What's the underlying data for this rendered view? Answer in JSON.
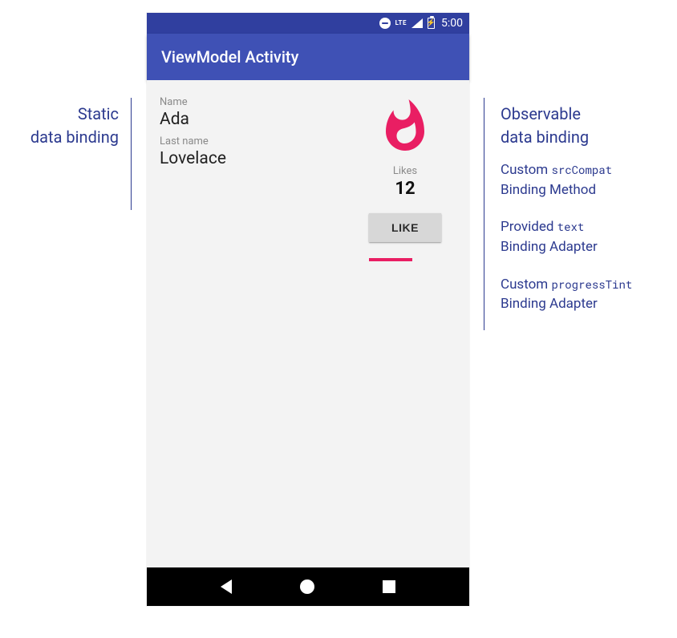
{
  "colors": {
    "primary": "#3f51b5",
    "primary_dark": "#303f9f",
    "accent": "#e91e63",
    "annotation": "#2c3a8f"
  },
  "statusbar": {
    "time": "5:00",
    "network_label": "LTE"
  },
  "appbar": {
    "title": "ViewModel Activity"
  },
  "fields": {
    "name_label": "Name",
    "name_value": "Ada",
    "lastname_label": "Last name",
    "lastname_value": "Lovelace"
  },
  "likes": {
    "label": "Likes",
    "count": "12",
    "button_label": "LIKE",
    "progress_percent": 60
  },
  "annotations": {
    "left_heading_line1": "Static",
    "left_heading_line2": "data binding",
    "right_heading_line1": "Observable",
    "right_heading_line2": "data binding",
    "item1_prefix": "Custom ",
    "item1_code": "srcCompat",
    "item1_line2": "Binding Method",
    "item2_prefix": "Provided ",
    "item2_code": "text",
    "item2_line2": "Binding Adapter",
    "item3_prefix": "Custom ",
    "item3_code": "progressTint",
    "item3_line2": "Binding Adapter"
  }
}
